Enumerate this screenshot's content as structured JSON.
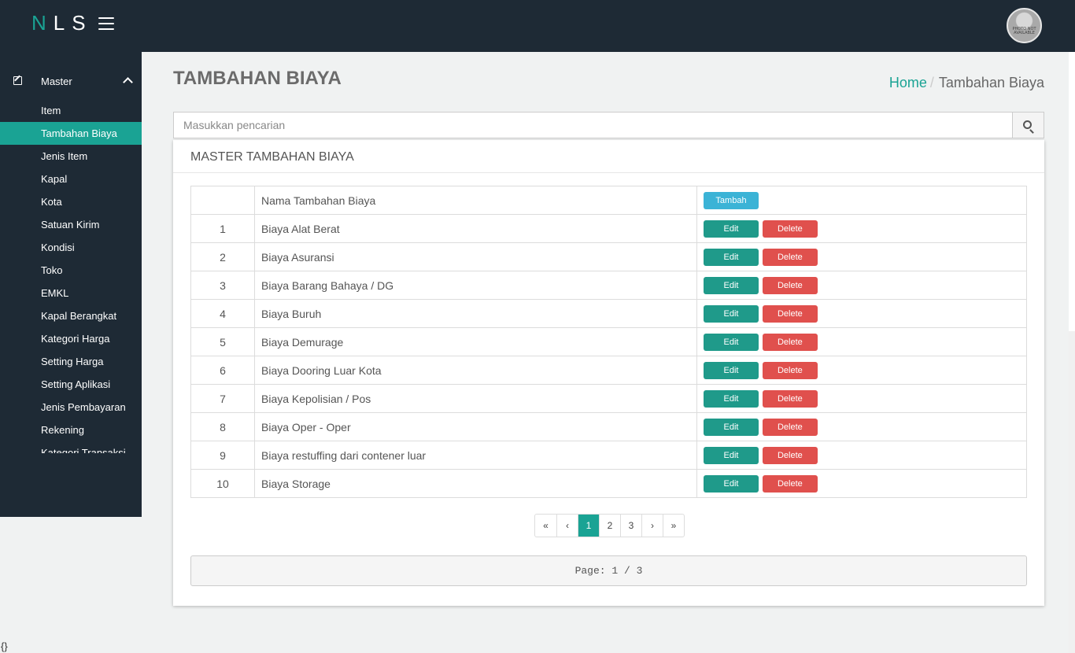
{
  "topbar": {
    "logo_n": "N",
    "logo_ls": "LS",
    "menu_icon": "hamburger-icon",
    "avatar_text": "PHOTO NOT AVAILABLE"
  },
  "sidebar": {
    "section_label": "Master",
    "section_icon": "edit-icon",
    "items": [
      {
        "label": "Item",
        "active": false
      },
      {
        "label": "Tambahan Biaya",
        "active": true
      },
      {
        "label": "Jenis Item",
        "active": false
      },
      {
        "label": "Kapal",
        "active": false
      },
      {
        "label": "Kota",
        "active": false
      },
      {
        "label": "Satuan Kirim",
        "active": false
      },
      {
        "label": "Kondisi",
        "active": false
      },
      {
        "label": "Toko",
        "active": false
      },
      {
        "label": "EMKL",
        "active": false
      },
      {
        "label": "Kapal Berangkat",
        "active": false
      },
      {
        "label": "Kategori Harga",
        "active": false
      },
      {
        "label": "Setting Harga",
        "active": false
      },
      {
        "label": "Setting Aplikasi",
        "active": false
      },
      {
        "label": "Jenis Pembayaran",
        "active": false
      },
      {
        "label": "Rekening",
        "active": false
      },
      {
        "label": "Kategori Transaksi",
        "active": false
      }
    ]
  },
  "header": {
    "title": "TAMBAHAN BIAYA",
    "breadcrumb_home": "Home",
    "breadcrumb_sep": "/",
    "breadcrumb_current": "Tambahan Biaya"
  },
  "search": {
    "placeholder": "Masukkan pencarian",
    "value": ""
  },
  "panel": {
    "title": "MASTER TAMBAHAN BIAYA",
    "column_name": "Nama Tambahan Biaya",
    "add_label": "Tambah",
    "edit_label": "Edit",
    "delete_label": "Delete",
    "rows": [
      {
        "no": "1",
        "name": "Biaya Alat Berat"
      },
      {
        "no": "2",
        "name": "Biaya Asuransi"
      },
      {
        "no": "3",
        "name": "Biaya Barang Bahaya / DG"
      },
      {
        "no": "4",
        "name": "Biaya Buruh"
      },
      {
        "no": "5",
        "name": "Biaya Demurage"
      },
      {
        "no": "6",
        "name": "Biaya Dooring Luar Kota"
      },
      {
        "no": "7",
        "name": "Biaya Kepolisian / Pos"
      },
      {
        "no": "8",
        "name": "Biaya Oper - Oper"
      },
      {
        "no": "9",
        "name": "Biaya restuffing dari contener luar"
      },
      {
        "no": "10",
        "name": "Biaya Storage"
      }
    ]
  },
  "pagination": {
    "first": "«",
    "prev": "‹",
    "next": "›",
    "last": "»",
    "pages": [
      "1",
      "2",
      "3"
    ],
    "current_page": "1"
  },
  "page_info": "Page: 1 / 3",
  "footer_text": "{}",
  "colors": {
    "accent": "#1aa394",
    "sidebar_bg": "#1e2a35",
    "edit": "#1f9a8a",
    "delete": "#e0504d",
    "add": "#3bb3d6"
  }
}
